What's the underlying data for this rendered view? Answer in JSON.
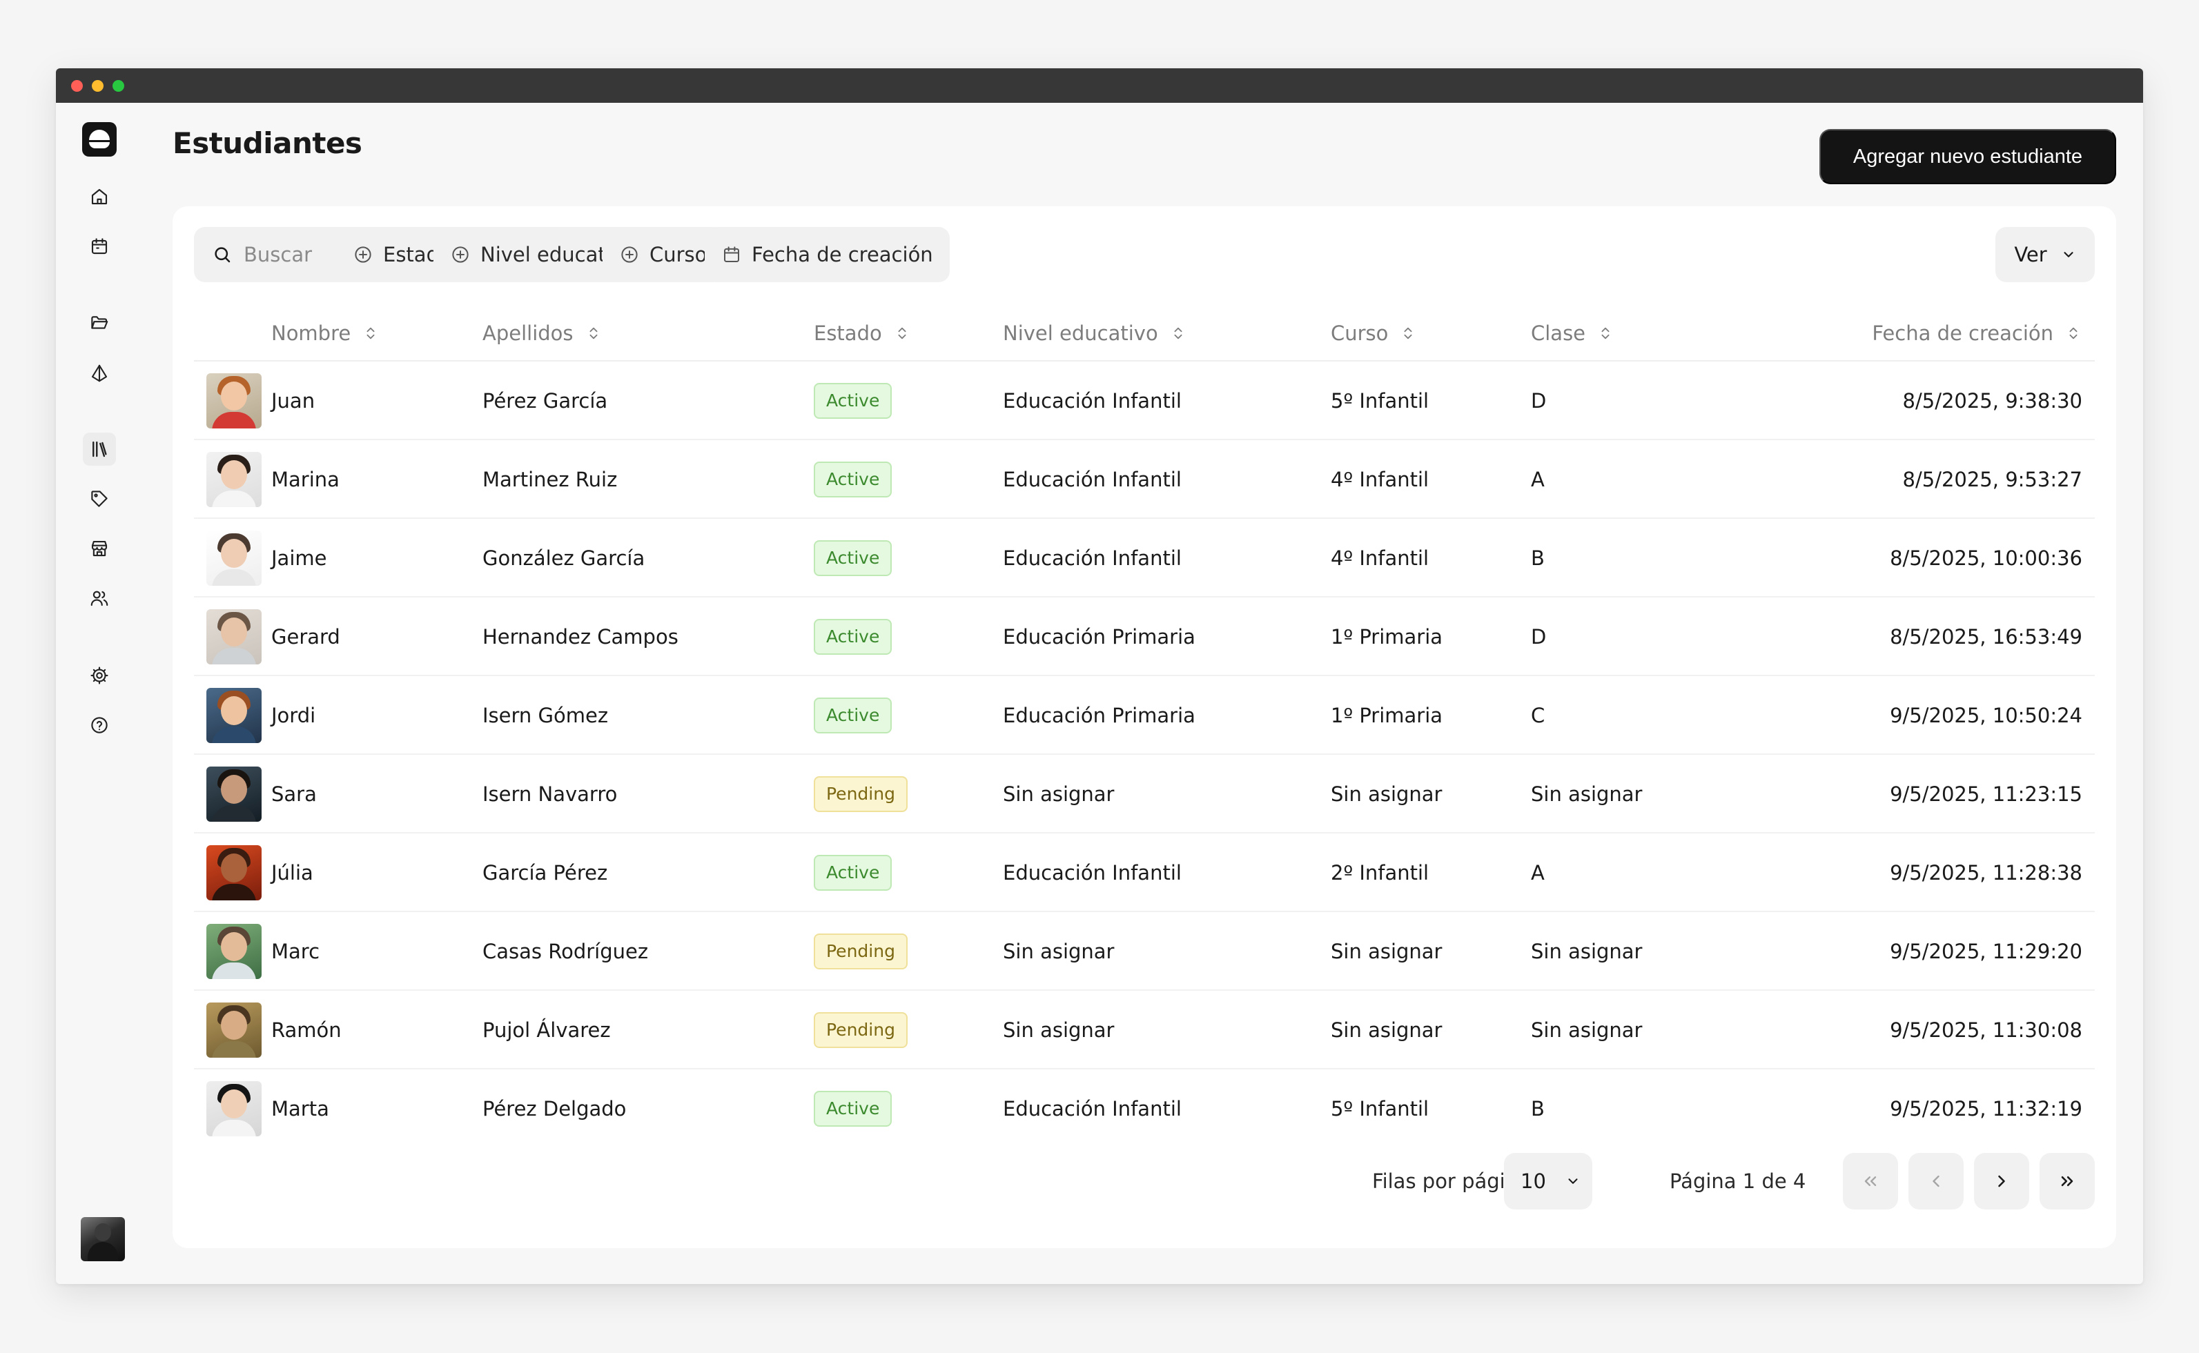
{
  "app": {
    "page_title": "Estudiantes",
    "add_button_label": "Agregar nuevo estudiante"
  },
  "sidebar": {
    "items": [
      {
        "icon": "home-icon",
        "active": false
      },
      {
        "icon": "calendar-icon",
        "active": false
      },
      {
        "icon": "folder-icon",
        "active": false
      },
      {
        "icon": "shapes-icon",
        "active": false
      },
      {
        "icon": "library-icon",
        "active": true
      },
      {
        "icon": "tag-icon",
        "active": false
      },
      {
        "icon": "store-icon",
        "active": false
      },
      {
        "icon": "users-icon",
        "active": false
      },
      {
        "icon": "settings-icon",
        "active": false
      },
      {
        "icon": "help-icon",
        "active": false
      }
    ]
  },
  "toolbar": {
    "search_placeholder": "Buscar",
    "filters": [
      "Estado",
      "Nivel educativo",
      "Curso",
      "Fecha de creación"
    ],
    "view_label": "Ver"
  },
  "table": {
    "columns": [
      "Nombre",
      "Apellidos",
      "Estado",
      "Nivel educativo",
      "Curso",
      "Clase",
      "Fecha de creación"
    ],
    "rows": [
      {
        "nombre": "Juan",
        "apellidos": "Pérez García",
        "estado": "Active",
        "nivel": "Educación Infantil",
        "curso": "5º Infantil",
        "clase": "D",
        "fecha": "8/5/2025, 9:38:30"
      },
      {
        "nombre": "Marina",
        "apellidos": "Martinez Ruiz",
        "estado": "Active",
        "nivel": "Educación Infantil",
        "curso": "4º Infantil",
        "clase": "A",
        "fecha": "8/5/2025, 9:53:27"
      },
      {
        "nombre": "Jaime",
        "apellidos": "González García",
        "estado": "Active",
        "nivel": "Educación Infantil",
        "curso": "4º Infantil",
        "clase": "B",
        "fecha": "8/5/2025, 10:00:36"
      },
      {
        "nombre": "Gerard",
        "apellidos": "Hernandez Campos",
        "estado": "Active",
        "nivel": "Educación Primaria",
        "curso": "1º Primaria",
        "clase": "D",
        "fecha": "8/5/2025, 16:53:49"
      },
      {
        "nombre": "Jordi",
        "apellidos": "Isern Gómez",
        "estado": "Active",
        "nivel": "Educación Primaria",
        "curso": "1º Primaria",
        "clase": "C",
        "fecha": "9/5/2025, 10:50:24"
      },
      {
        "nombre": "Sara",
        "apellidos": "Isern Navarro",
        "estado": "Pending",
        "nivel": "Sin asignar",
        "curso": "Sin asignar",
        "clase": "Sin asignar",
        "fecha": "9/5/2025, 11:23:15"
      },
      {
        "nombre": "Júlia",
        "apellidos": "García Pérez",
        "estado": "Active",
        "nivel": "Educación Infantil",
        "curso": "2º Infantil",
        "clase": "A",
        "fecha": "9/5/2025, 11:28:38"
      },
      {
        "nombre": "Marc",
        "apellidos": "Casas Rodríguez",
        "estado": "Pending",
        "nivel": "Sin asignar",
        "curso": "Sin asignar",
        "clase": "Sin asignar",
        "fecha": "9/5/2025, 11:29:20"
      },
      {
        "nombre": "Ramón",
        "apellidos": "Pujol Álvarez",
        "estado": "Pending",
        "nivel": "Sin asignar",
        "curso": "Sin asignar",
        "clase": "Sin asignar",
        "fecha": "9/5/2025, 11:30:08"
      },
      {
        "nombre": "Marta",
        "apellidos": "Pérez Delgado",
        "estado": "Active",
        "nivel": "Educación Infantil",
        "curso": "5º Infantil",
        "clase": "B",
        "fecha": "9/5/2025, 11:32:19"
      }
    ]
  },
  "pagination": {
    "rows_per_page_label": "Filas por página",
    "rows_per_page_value": "10",
    "page_label": "Página 1 de 4"
  },
  "colors": {
    "primary": "#141414",
    "active_badge_bg": "#e5f8e0",
    "active_badge_text": "#3c8a2e",
    "pending_badge_bg": "#fcf5d2",
    "pending_badge_text": "#7c6812"
  }
}
